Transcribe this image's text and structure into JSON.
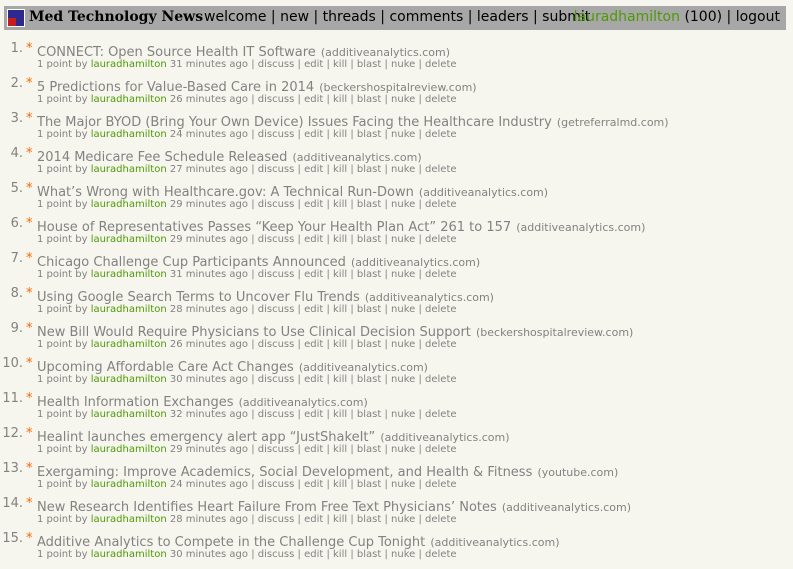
{
  "header": {
    "site_title": "Med Technology News",
    "nav": [
      "welcome",
      "new",
      "threads",
      "comments",
      "leaders",
      "submit"
    ],
    "username": "lauradhamilton",
    "karma": "(100)",
    "logout": "logout"
  },
  "stories": [
    {
      "rank": "1.",
      "title": "CONNECT: Open Source Health IT Software",
      "domain": "(additiveanalytics.com)",
      "points": "1 point by",
      "user": "lauradhamilton",
      "age": "31 minutes ago"
    },
    {
      "rank": "2.",
      "title": "5 Predictions for Value-Based Care in 2014",
      "domain": "(beckershospitalreview.com)",
      "points": "1 point by",
      "user": "lauradhamilton",
      "age": "26 minutes ago"
    },
    {
      "rank": "3.",
      "title": "The Major BYOD (Bring Your Own Device) Issues Facing the Healthcare Industry",
      "domain": "(getreferralmd.com)",
      "points": "1 point by",
      "user": "lauradhamilton",
      "age": "24 minutes ago"
    },
    {
      "rank": "4.",
      "title": "2014 Medicare Fee Schedule Released",
      "domain": "(additiveanalytics.com)",
      "points": "1 point by",
      "user": "lauradhamilton",
      "age": "27 minutes ago"
    },
    {
      "rank": "5.",
      "title": "What’s Wrong with Healthcare.gov: A Technical Run-Down",
      "domain": "(additiveanalytics.com)",
      "points": "1 point by",
      "user": "lauradhamilton",
      "age": "29 minutes ago"
    },
    {
      "rank": "6.",
      "title": "House of Representatives Passes “Keep Your Health Plan Act” 261 to 157",
      "domain": "(additiveanalytics.com)",
      "points": "1 point by",
      "user": "lauradhamilton",
      "age": "29 minutes ago"
    },
    {
      "rank": "7.",
      "title": "Chicago Challenge Cup Participants Announced",
      "domain": "(additiveanalytics.com)",
      "points": "1 point by",
      "user": "lauradhamilton",
      "age": "31 minutes ago"
    },
    {
      "rank": "8.",
      "title": "Using Google Search Terms to Uncover Flu Trends",
      "domain": "(additiveanalytics.com)",
      "points": "1 point by",
      "user": "lauradhamilton",
      "age": "28 minutes ago"
    },
    {
      "rank": "9.",
      "title": "New Bill Would Require Physicians to Use Clinical Decision Support",
      "domain": "(beckershospitalreview.com)",
      "points": "1 point by",
      "user": "lauradhamilton",
      "age": "26 minutes ago"
    },
    {
      "rank": "10.",
      "title": "Upcoming Affordable Care Act Changes",
      "domain": "(additiveanalytics.com)",
      "points": "1 point by",
      "user": "lauradhamilton",
      "age": "30 minutes ago"
    },
    {
      "rank": "11.",
      "title": "Health Information Exchanges",
      "domain": "(additiveanalytics.com)",
      "points": "1 point by",
      "user": "lauradhamilton",
      "age": "32 minutes ago"
    },
    {
      "rank": "12.",
      "title": "Healint launches emergency alert app “JustShakeIt”",
      "domain": "(additiveanalytics.com)",
      "points": "1 point by",
      "user": "lauradhamilton",
      "age": "29 minutes ago"
    },
    {
      "rank": "13.",
      "title": "Exergaming: Improve Academics, Social Development, and Health & Fitness",
      "domain": "(youtube.com)",
      "points": "1 point by",
      "user": "lauradhamilton",
      "age": "24 minutes ago"
    },
    {
      "rank": "14.",
      "title": "New Research Identifies Heart Failure From Free Text Physicians’ Notes",
      "domain": "(additiveanalytics.com)",
      "points": "1 point by",
      "user": "lauradhamilton",
      "age": "28 minutes ago"
    },
    {
      "rank": "15.",
      "title": "Additive Analytics to Compete in the Challenge Cup Tonight",
      "domain": "(additiveanalytics.com)",
      "points": "1 point by",
      "user": "lauradhamilton",
      "age": "30 minutes ago"
    }
  ],
  "actions": [
    "discuss",
    "edit",
    "kill",
    "blast",
    "nuke",
    "delete"
  ],
  "vote_icon": "upvote-star",
  "colors": {
    "header_bg": "#a7a7a7",
    "page_bg": "#f6f6ef",
    "accent": "#ff6600",
    "user": "#4e9a06"
  }
}
